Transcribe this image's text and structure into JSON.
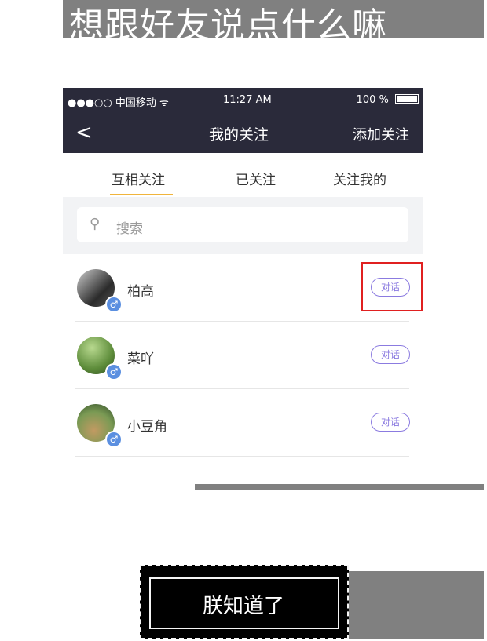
{
  "overlay": {
    "title": "想跟好友说点什么嘛"
  },
  "statusbar": {
    "carrier": "●●●○○ 中国移动 ᯤ",
    "time": "11:27 AM",
    "battery": "100 %"
  },
  "nav": {
    "back": "<",
    "title": "我的关注",
    "action": "添加关注"
  },
  "tabs": [
    {
      "label": "互相关注"
    },
    {
      "label": "已关注"
    },
    {
      "label": "关注我的"
    }
  ],
  "search": {
    "placeholder": "搜索",
    "icon": "search-icon"
  },
  "contacts": [
    {
      "name": "柏高",
      "action": "对话",
      "gender": "♂"
    },
    {
      "name": "菜吖",
      "action": "对话",
      "gender": "♂"
    },
    {
      "name": "小豆角",
      "action": "对话",
      "gender": "♂"
    }
  ],
  "cta": {
    "label": "朕知道了"
  },
  "colors": {
    "nav_bg": "#2a2a3a",
    "tab_underline": "#f0b43c",
    "chat_button": "#8b7be0",
    "gender_badge": "#5b8fe0",
    "highlight_box": "#e02020",
    "overlay_gray": "#808080"
  }
}
